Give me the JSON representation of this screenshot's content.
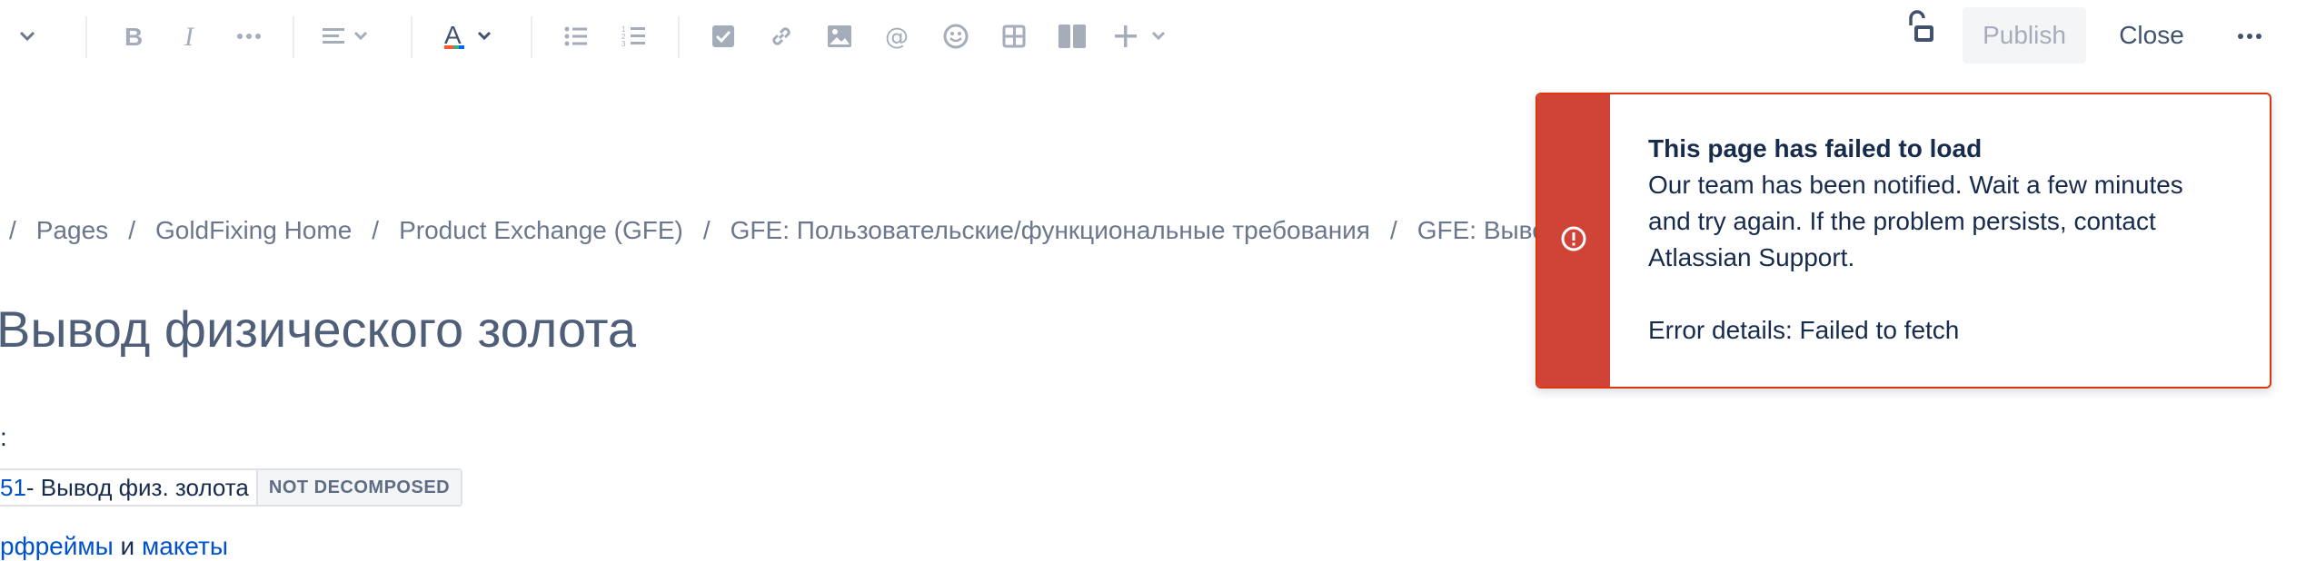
{
  "toolbar": {
    "icons": [
      "chevron-down-icon",
      "bold-icon",
      "italic-icon",
      "more-formatting-icon",
      "align-icon",
      "text-color-icon",
      "bullet-list-icon",
      "numbered-list-icon",
      "task-list-icon",
      "link-icon",
      "image-icon",
      "mention-icon",
      "emoji-icon",
      "table-icon",
      "layout-icon",
      "insert-plus-icon",
      "unlock-icon",
      "more-icon"
    ],
    "text_color_accent": "#ff5630",
    "publish_label": "Publish",
    "close_label": "Close"
  },
  "breadcrumb": {
    "separator": "/",
    "items": [
      "Pages",
      "GoldFixing Home",
      "Product Exchange (GFE)",
      "GFE: Пользовательские/функциональные требования",
      "GFE: Вывод фи"
    ]
  },
  "page": {
    "title": "Вывод физического золота",
    "colon_line": ":",
    "jira": {
      "key": "51",
      "summary": " - Вывод физ. золота",
      "status": "NOT DECOMPOSED"
    },
    "links_line": {
      "link1": "рфреймы",
      "middle": " и ",
      "link2": "макеты"
    }
  },
  "flag": {
    "title": "This page has failed to load",
    "message": "Our team has been notified. Wait a few minutes and try again. If the problem persists, contact Atlassian Support.",
    "details": "Error details: Failed to fetch",
    "accent_color": "#d04437"
  }
}
